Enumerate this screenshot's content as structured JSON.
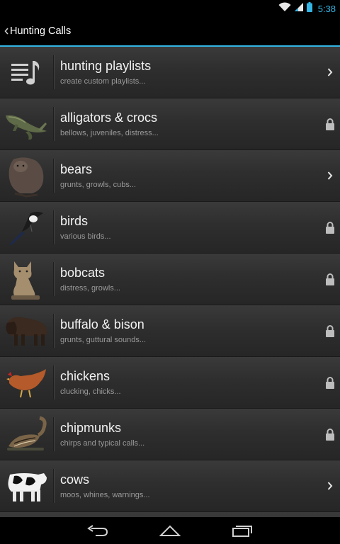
{
  "status_bar": {
    "time": "5:38",
    "icons": [
      "wifi-icon",
      "signal-icon",
      "battery-icon"
    ],
    "accent_color": "#33b5e5"
  },
  "action_bar": {
    "title": "Hunting Calls",
    "back_icon": "chevron-left-icon"
  },
  "list": {
    "items": [
      {
        "title": "hunting playlists",
        "subtitle": "create custom playlists...",
        "icon": "playlist-music-icon",
        "indicator": "chevron-right"
      },
      {
        "title": "alligators & crocs",
        "subtitle": "bellows, juveniles, distress...",
        "icon": "alligator-image",
        "indicator": "lock"
      },
      {
        "title": "bears",
        "subtitle": "grunts, growls, cubs...",
        "icon": "bear-image",
        "indicator": "chevron-right"
      },
      {
        "title": "birds",
        "subtitle": "various birds...",
        "icon": "magpie-image",
        "indicator": "lock"
      },
      {
        "title": "bobcats",
        "subtitle": "distress, growls...",
        "icon": "bobcat-image",
        "indicator": "lock"
      },
      {
        "title": "buffalo & bison",
        "subtitle": "grunts, guttural sounds...",
        "icon": "bison-image",
        "indicator": "lock"
      },
      {
        "title": "chickens",
        "subtitle": "clucking, chicks...",
        "icon": "chicken-image",
        "indicator": "lock"
      },
      {
        "title": "chipmunks",
        "subtitle": "chirps and typical calls...",
        "icon": "chipmunk-image",
        "indicator": "lock"
      },
      {
        "title": "cows",
        "subtitle": "moos, whines, warnings...",
        "icon": "cow-image",
        "indicator": "chevron-right"
      }
    ]
  },
  "nav_bar": {
    "buttons": [
      "back-icon",
      "home-icon",
      "recent-apps-icon"
    ]
  }
}
